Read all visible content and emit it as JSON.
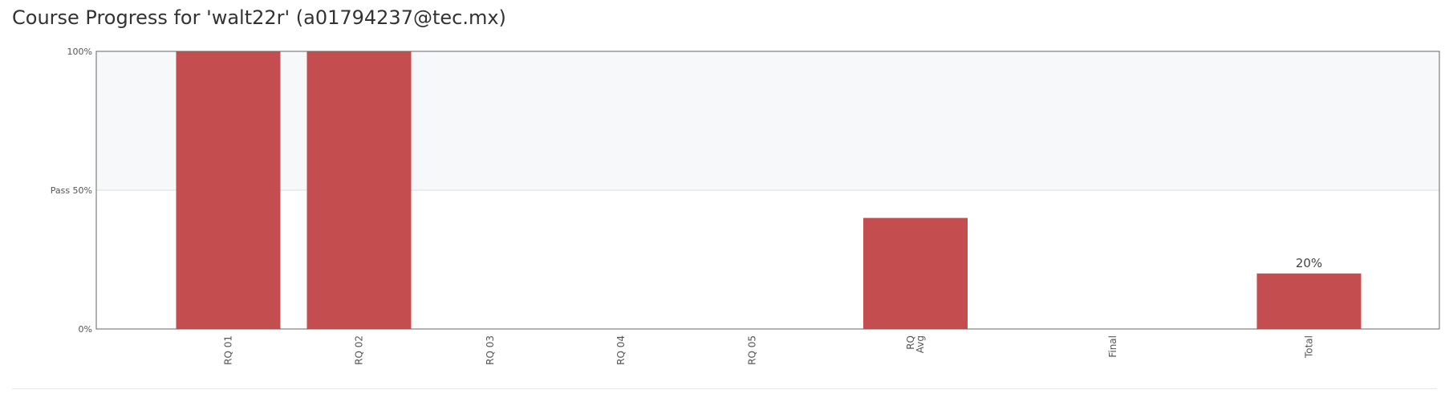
{
  "page": {
    "title": "Course Progress for 'walt22r' (a01794237@tec.mx)"
  },
  "colors": {
    "bar": "#c44d4f",
    "pass_band": "#f7f8f9",
    "grid": "#dddddd",
    "axis": "#666666",
    "text": "#555555"
  },
  "chart_data": {
    "type": "bar",
    "categories": [
      "RQ 01",
      "RQ 02",
      "RQ 03",
      "RQ 04",
      "RQ 05",
      "RQ Avg",
      "Final",
      "Total"
    ],
    "values": [
      100,
      100,
      0,
      0,
      0,
      40,
      0,
      20
    ],
    "ylim": [
      0,
      100
    ],
    "y_ticks": [
      {
        "value": 0,
        "label": "0%"
      },
      {
        "value": 50,
        "label": "Pass 50%"
      },
      {
        "value": 100,
        "label": "100%"
      }
    ],
    "pass_threshold": 50,
    "data_labels": [
      {
        "category": "Total",
        "label": "20%"
      }
    ],
    "grid": true
  }
}
